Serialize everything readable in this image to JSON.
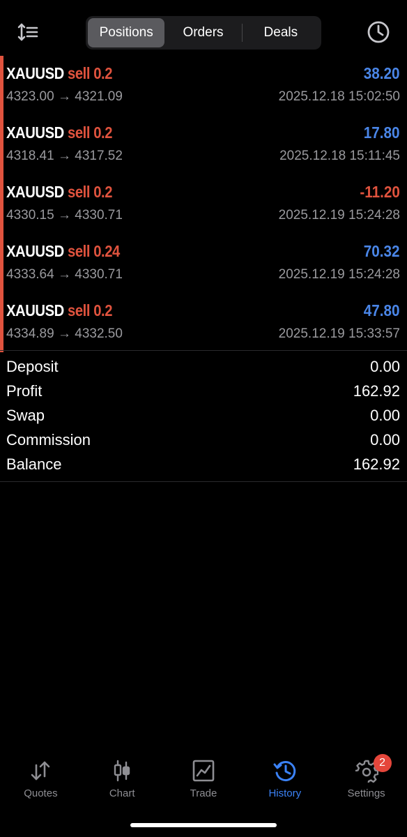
{
  "header": {
    "tabs": [
      {
        "label": "Positions",
        "active": true
      },
      {
        "label": "Orders",
        "active": false
      },
      {
        "label": "Deals",
        "active": false
      }
    ]
  },
  "deals": [
    {
      "symbol": "XAUUSD",
      "side": "sell",
      "volume": "0.2",
      "open_price": "4323.00",
      "close_price": "4321.09",
      "profit": "38.20",
      "time": "2025.12.18 15:02:50"
    },
    {
      "symbol": "XAUUSD",
      "side": "sell",
      "volume": "0.2",
      "open_price": "4318.41",
      "close_price": "4317.52",
      "profit": "17.80",
      "time": "2025.12.18 15:11:45"
    },
    {
      "symbol": "XAUUSD",
      "side": "sell",
      "volume": "0.2",
      "open_price": "4330.15",
      "close_price": "4330.71",
      "profit": "-11.20",
      "time": "2025.12.19 15:24:28"
    },
    {
      "symbol": "XAUUSD",
      "side": "sell",
      "volume": "0.24",
      "open_price": "4333.64",
      "close_price": "4330.71",
      "profit": "70.32",
      "time": "2025.12.19 15:24:28"
    },
    {
      "symbol": "XAUUSD",
      "side": "sell",
      "volume": "0.2",
      "open_price": "4334.89",
      "close_price": "4332.50",
      "profit": "47.80",
      "time": "2025.12.19 15:33:57"
    }
  ],
  "arrow": "→",
  "summary": [
    {
      "label": "Deposit",
      "value": "0.00"
    },
    {
      "label": "Profit",
      "value": "162.92"
    },
    {
      "label": "Swap",
      "value": "0.00"
    },
    {
      "label": "Commission",
      "value": "0.00"
    },
    {
      "label": "Balance",
      "value": "162.92"
    }
  ],
  "tabbar": {
    "items": [
      {
        "label": "Quotes",
        "icon": "quotes-arrows-icon",
        "active": false
      },
      {
        "label": "Chart",
        "icon": "candlestick-icon",
        "active": false
      },
      {
        "label": "Trade",
        "icon": "trade-chart-icon",
        "active": false
      },
      {
        "label": "History",
        "icon": "history-clock-icon",
        "active": true
      },
      {
        "label": "Settings",
        "icon": "gear-icon",
        "active": false,
        "badge": "2"
      }
    ]
  },
  "colors": {
    "sell": "#e0533e",
    "profit_positive": "#4a86e8",
    "profit_negative": "#e0533e",
    "active_tab": "#3b82f6",
    "inactive_tab": "#8e8e93",
    "badge": "#e5463b"
  }
}
